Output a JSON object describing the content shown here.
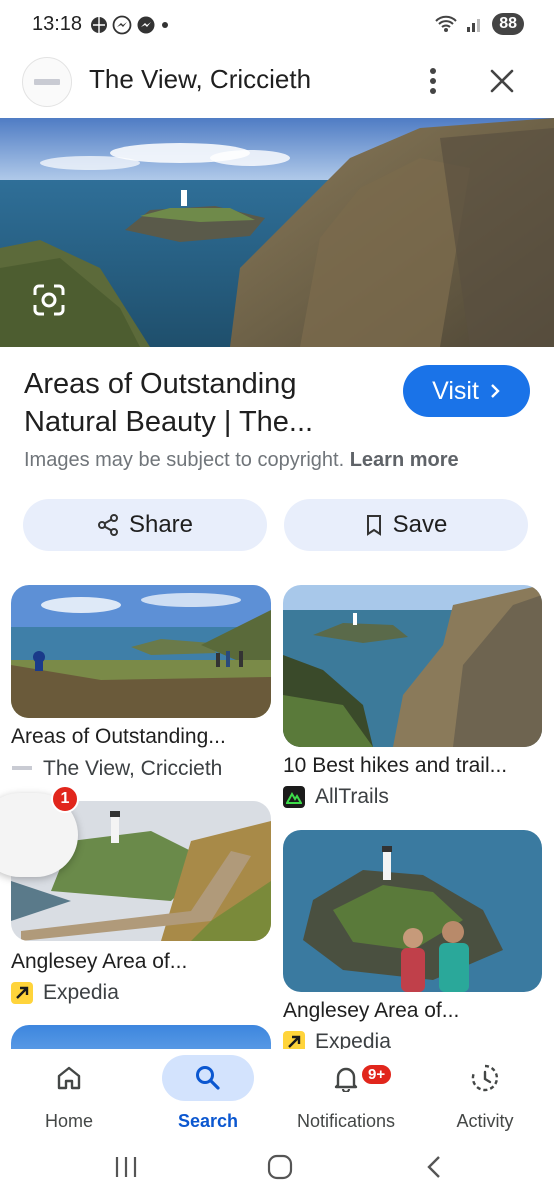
{
  "status_bar": {
    "time": "13:18",
    "battery": "88"
  },
  "header": {
    "title": "The View, Criccieth"
  },
  "result": {
    "title": "Areas of Outstanding Natural Beauty | The...",
    "visit_label": "Visit",
    "copyright_text": "Images may be subject to copyright.",
    "learn_more": "Learn more",
    "share_label": "Share",
    "save_label": "Save"
  },
  "grid": {
    "left": [
      {
        "title": "Areas of Outstanding...",
        "source": "The View, Criccieth"
      },
      {
        "title": "Anglesey Area of...",
        "source": "Expedia"
      }
    ],
    "right": [
      {
        "title": "10 Best hikes and trail...",
        "source": "AllTrails"
      },
      {
        "title": "Anglesey Area of...",
        "source": "Expedia"
      }
    ]
  },
  "bubble": {
    "badge": "1"
  },
  "bottom_nav": {
    "items": [
      {
        "label": "Home",
        "icon": "home-icon"
      },
      {
        "label": "Search",
        "icon": "search-icon",
        "active": true
      },
      {
        "label": "Notifications",
        "icon": "bell-icon",
        "badge": "9+"
      },
      {
        "label": "Activity",
        "icon": "activity-icon"
      }
    ]
  },
  "colors": {
    "accent": "#1a73e8",
    "active_nav": "#0b57d0",
    "pill_bg": "#e8eefb",
    "badge": "#e1261c"
  }
}
